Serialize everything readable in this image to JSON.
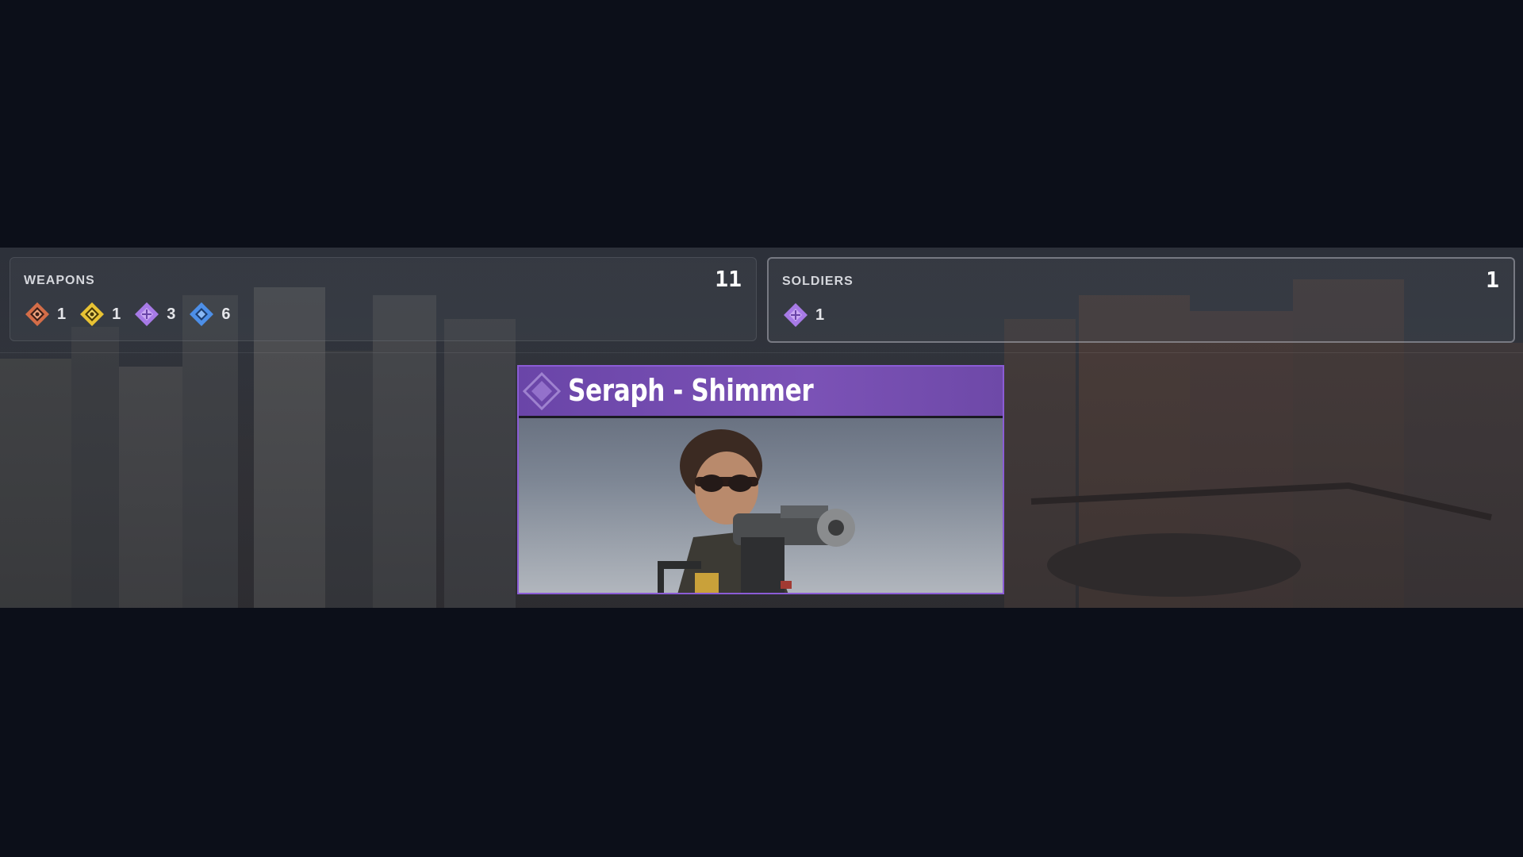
{
  "weapons": {
    "label": "WEAPONS",
    "total": "11",
    "rarities": [
      {
        "icon": "exotic-rarity-icon",
        "color": "#e07a54",
        "count": "1"
      },
      {
        "icon": "legendary-rarity-icon",
        "color": "#e8c233",
        "count": "1"
      },
      {
        "icon": "epic-rarity-icon",
        "color": "#a77ae6",
        "count": "3"
      },
      {
        "icon": "rare-rarity-icon",
        "color": "#4d8fe8",
        "count": "6"
      }
    ]
  },
  "soldiers": {
    "label": "SOLDIERS",
    "total": "1",
    "rarities": [
      {
        "icon": "epic-rarity-icon",
        "color": "#a77ae6",
        "count": "1"
      }
    ]
  },
  "reward_card": {
    "title": "Seraph - Shimmer",
    "rarity": "epic",
    "accent_color": "#8b5cd6"
  }
}
